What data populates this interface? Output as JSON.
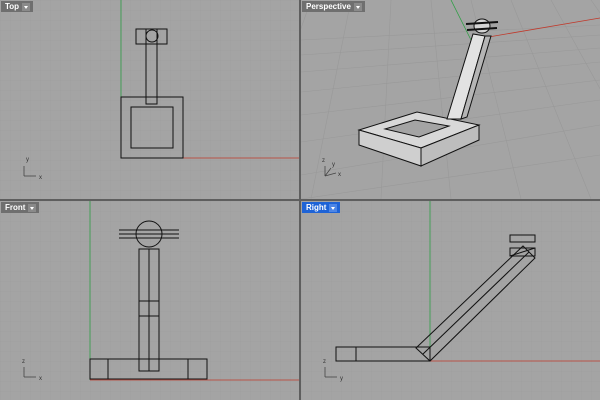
{
  "viewports": {
    "top": {
      "label": "Top",
      "icon": "chevron-down-icon",
      "active": false
    },
    "perspective": {
      "label": "Perspective",
      "icon": "chevron-down-icon",
      "active": false
    },
    "front": {
      "label": "Front",
      "icon": "chevron-down-icon",
      "active": false
    },
    "right": {
      "label": "Right",
      "icon": "chevron-down-icon",
      "active": true
    }
  },
  "axis_labels": {
    "top": [
      "y",
      "x"
    ],
    "perspective": [
      "z",
      "y",
      "x"
    ],
    "front": [
      "z",
      "x"
    ],
    "right": [
      "z",
      "y"
    ]
  },
  "colors": {
    "viewport_bg": "#a4a4a4",
    "grid_minor": "#9a9a9a",
    "grid_major": "#8c8c8c",
    "x_axis": "#c0392b",
    "y_axis": "#2e9e44",
    "object_outline": "#111111",
    "active_tab": "#1e63d6"
  }
}
